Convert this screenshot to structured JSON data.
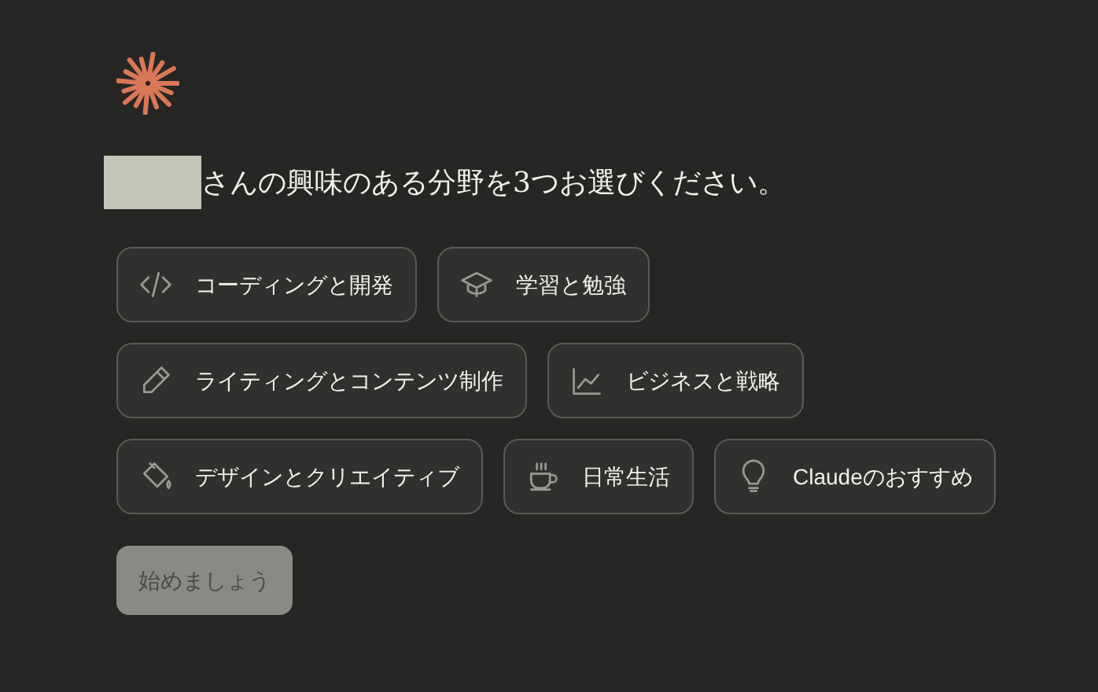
{
  "heading": "さんの興味のある分野を3つお選びください。",
  "interests": [
    {
      "kind": "code",
      "label": "コーディングと開発",
      "selected": false
    },
    {
      "kind": "learning",
      "label": "学習と勉強",
      "selected": false
    },
    {
      "kind": "writing",
      "label": "ライティングとコンテンツ制作",
      "selected": false
    },
    {
      "kind": "chart",
      "label": "ビジネスと戦略",
      "selected": false
    },
    {
      "kind": "paint",
      "label": "デザインとクリエイティブ",
      "selected": false
    },
    {
      "kind": "cup",
      "label": "日常生活",
      "selected": false
    },
    {
      "kind": "bulb",
      "label": "Claudeのおすすめ",
      "selected": false
    }
  ],
  "start_button": {
    "label": "始めましょう",
    "disabled": true
  }
}
